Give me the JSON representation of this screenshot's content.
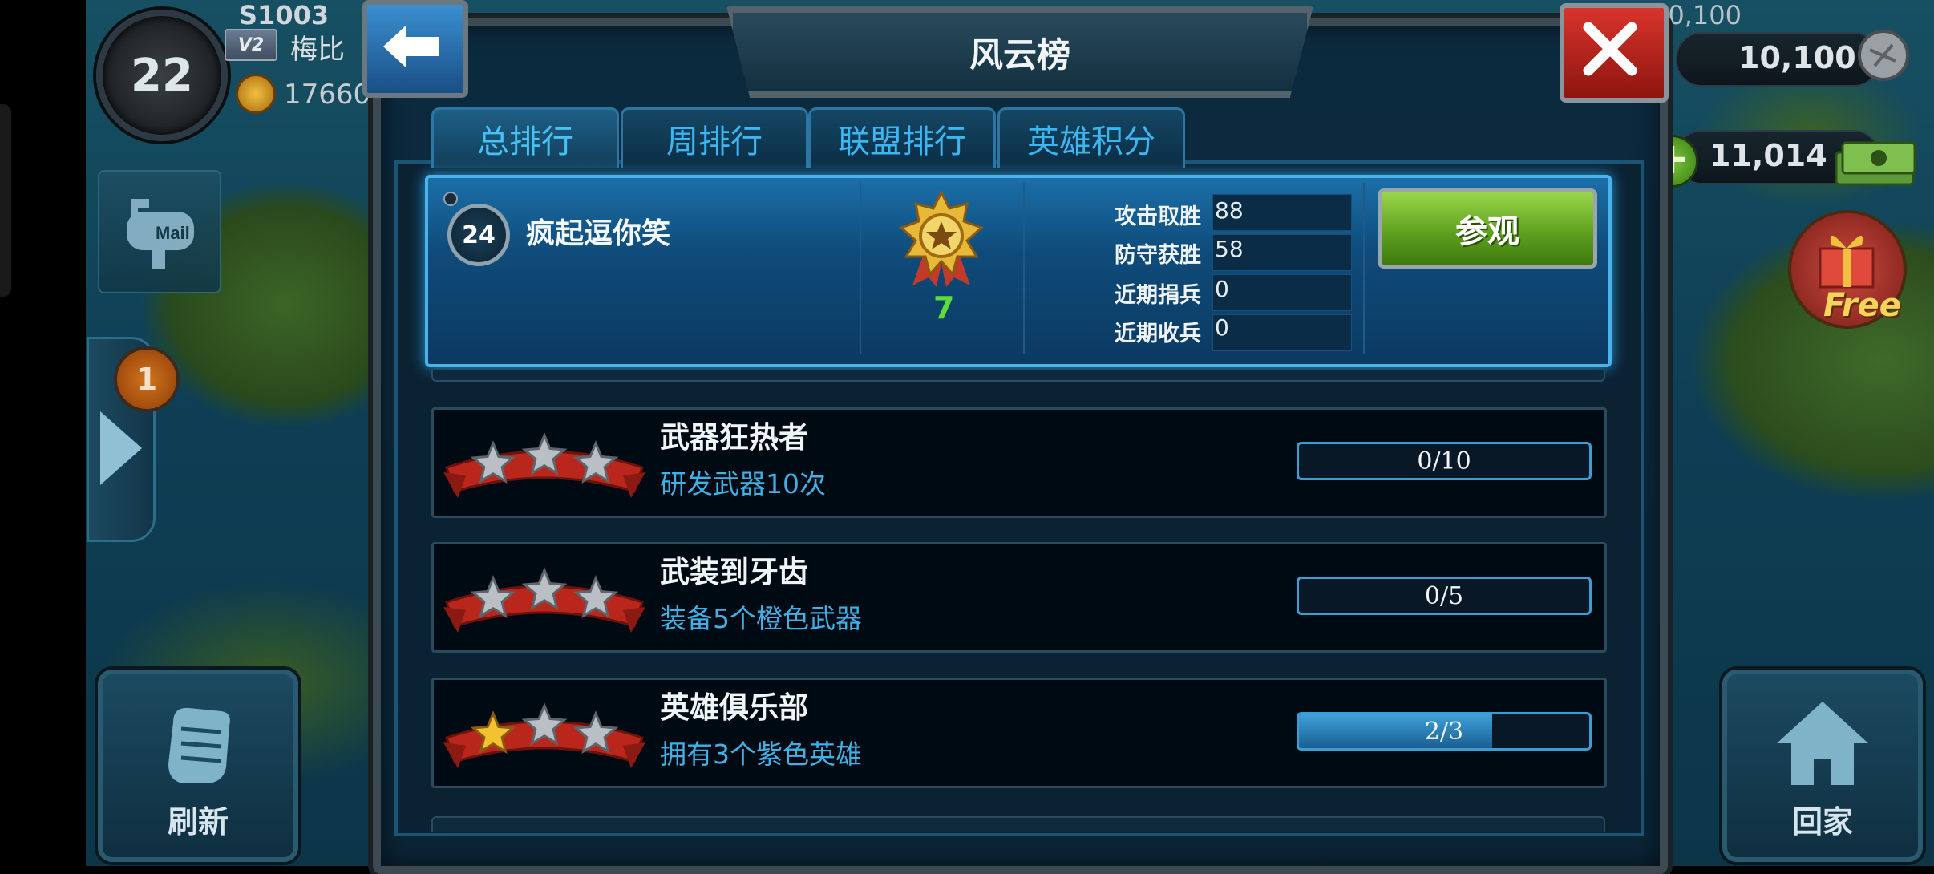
{
  "hud": {
    "level": "22",
    "vip": "V2",
    "server_tag": "S1003",
    "player_name": "梅比",
    "power": "17660",
    "mail_label": "Mail",
    "notification_count": "1",
    "refresh_label": "刷新",
    "home_label": "回家",
    "resource_top": "10,100",
    "resource_1": "10,100",
    "resource_2": "11,014",
    "free_label": "Free"
  },
  "dialog": {
    "title": "风云榜",
    "tabs": [
      {
        "label": "总排行"
      },
      {
        "label": "周排行"
      },
      {
        "label": "联盟排行"
      },
      {
        "label": "英雄积分"
      }
    ]
  },
  "player_card": {
    "rank": "24",
    "name": "疯起逗你笑",
    "medal_level": "7",
    "stats": [
      {
        "label": "攻击取胜",
        "value": "88"
      },
      {
        "label": "防守获胜",
        "value": "58"
      },
      {
        "label": "近期捐兵",
        "value": "0"
      },
      {
        "label": "近期收兵",
        "value": "0"
      }
    ],
    "visit_label": "参观"
  },
  "achievements": [
    {
      "title": "武器狂热者",
      "desc": "研发武器10次",
      "progress_text": "0/10",
      "progress": 0.0,
      "gold_stars": 0
    },
    {
      "title": "武装到牙齿",
      "desc": "装备5个橙色武器",
      "progress_text": "0/5",
      "progress": 0.0,
      "gold_stars": 0
    },
    {
      "title": "英雄俱乐部",
      "desc": "拥有3个紫色英雄",
      "progress_text": "2/3",
      "progress": 0.667,
      "gold_stars": 1
    }
  ],
  "colors": {
    "accent_blue": "#3db5f0",
    "progress_green": "#5ddc3a",
    "visit_green": "#5ea21f",
    "close_red": "#d8342c"
  }
}
